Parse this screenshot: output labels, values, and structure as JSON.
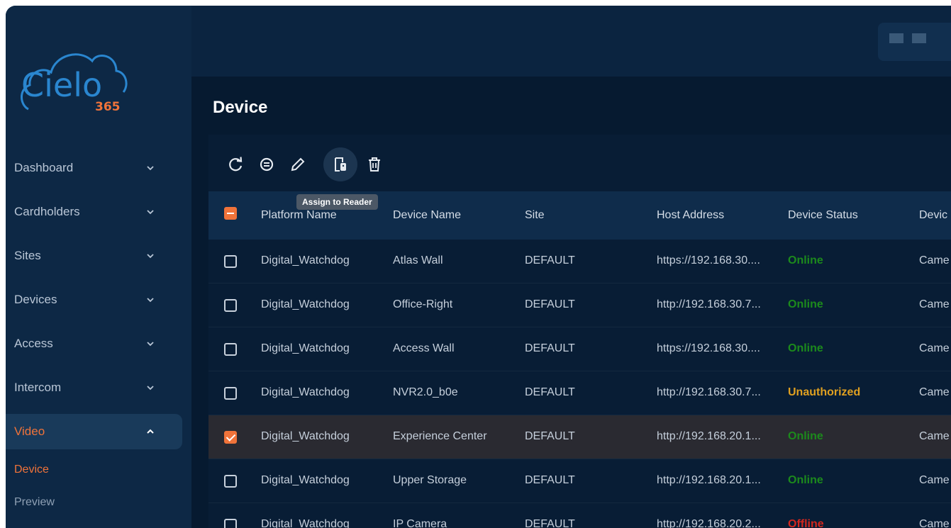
{
  "app": {
    "logo_number": "365"
  },
  "colors": {
    "accent": "#f0733a",
    "online": "#1c8a1c",
    "unauthorized": "#e0a020",
    "offline": "#d4261e"
  },
  "sidebar": {
    "items": [
      {
        "label": "Dashboard",
        "expanded": false
      },
      {
        "label": "Cardholders",
        "expanded": false
      },
      {
        "label": "Sites",
        "expanded": false
      },
      {
        "label": "Devices",
        "expanded": false
      },
      {
        "label": "Access",
        "expanded": false
      },
      {
        "label": "Intercom",
        "expanded": false
      },
      {
        "label": "Video",
        "expanded": true
      }
    ],
    "subitems": [
      {
        "label": "Device",
        "active": true
      },
      {
        "label": "Preview",
        "active": false
      }
    ]
  },
  "page": {
    "title": "Device"
  },
  "toolbar": {
    "icons": [
      "refresh-icon",
      "sync-icon",
      "edit-icon",
      "assign-reader-icon",
      "delete-icon"
    ],
    "tooltip": "Assign to Reader"
  },
  "table": {
    "headers": [
      "Platform Name",
      "Device Name",
      "Site",
      "Host Address",
      "Device Status",
      "Devic"
    ],
    "rows": [
      {
        "platform": "Digital_Watchdog",
        "device": "Atlas Wall",
        "site": "DEFAULT",
        "host": "https://192.168.30....",
        "status": "Online",
        "type": "Came",
        "selected": false
      },
      {
        "platform": "Digital_Watchdog",
        "device": "Office-Right",
        "site": "DEFAULT",
        "host": "http://192.168.30.7...",
        "status": "Online",
        "type": "Came",
        "selected": false
      },
      {
        "platform": "Digital_Watchdog",
        "device": "Access Wall",
        "site": "DEFAULT",
        "host": "https://192.168.30....",
        "status": "Online",
        "type": "Came",
        "selected": false
      },
      {
        "platform": "Digital_Watchdog",
        "device": "NVR2.0_b0e",
        "site": "DEFAULT",
        "host": "http://192.168.30.7...",
        "status": "Unauthorized",
        "type": "Came",
        "selected": false
      },
      {
        "platform": "Digital_Watchdog",
        "device": "Experience Center",
        "site": "DEFAULT",
        "host": "http://192.168.20.1...",
        "status": "Online",
        "type": "Came",
        "selected": true
      },
      {
        "platform": "Digital_Watchdog",
        "device": "Upper Storage",
        "site": "DEFAULT",
        "host": "http://192.168.20.1...",
        "status": "Online",
        "type": "Came",
        "selected": false
      },
      {
        "platform": "Digital_Watchdog",
        "device": "IP Camera",
        "site": "DEFAULT",
        "host": "http://192.168.20.2...",
        "status": "Offline",
        "type": "Came",
        "selected": false
      }
    ]
  }
}
